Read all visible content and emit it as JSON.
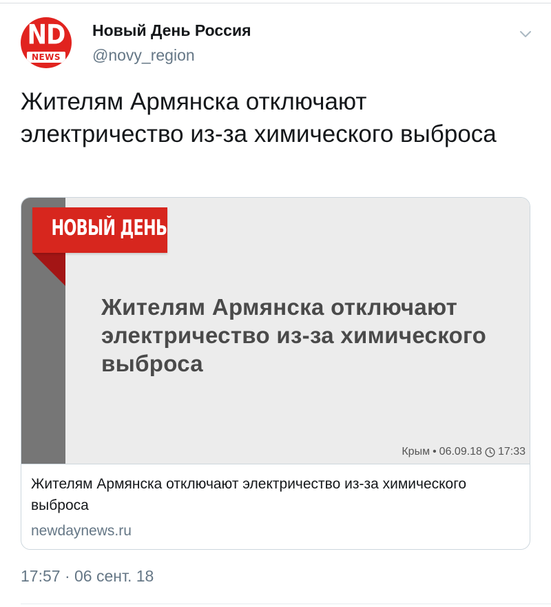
{
  "account": {
    "display_name": "Новый День Россия",
    "handle": "@novy_region",
    "avatar": {
      "top_text": "ND",
      "bottom_text": "NEWS",
      "background_color": "#e1231f"
    },
    "menu_icon": "chevron-down-icon"
  },
  "tweet": {
    "text": "Жителям Армянска отключают электричество из-за химического выброса",
    "timestamp": "17:57 · 06 сент. 18"
  },
  "link_card": {
    "image": {
      "brand_label": "НОВЫЙ ДЕНЬ",
      "headline": "Жителям Армянска отключают электричество из-за химического выброса",
      "region": "Крым",
      "separator": "•",
      "date": "06.09.18",
      "time": "17:33",
      "time_icon": "clock-icon",
      "brand_color": "#d7261e"
    },
    "title": "Жителям Армянска отключают электричество из-за химического выброса",
    "domain": "newdaynews.ru"
  }
}
